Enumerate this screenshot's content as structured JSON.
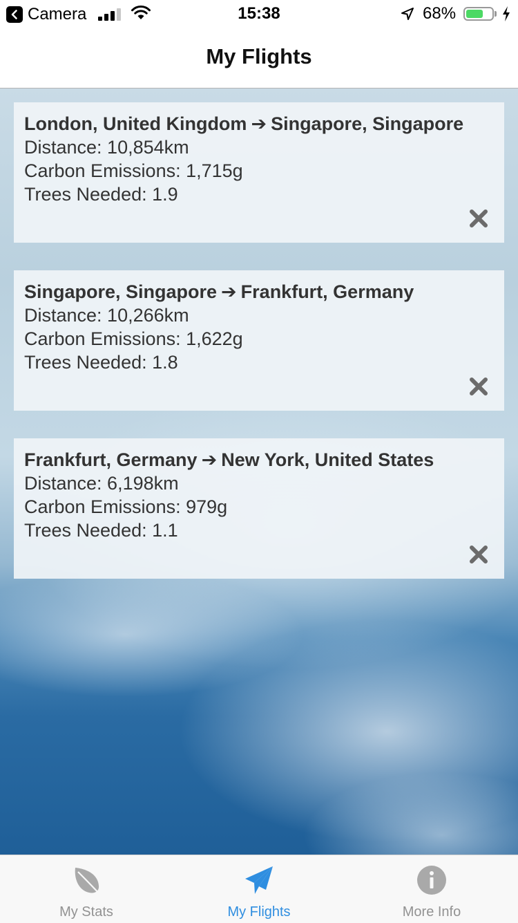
{
  "status_bar": {
    "back_app": "Camera",
    "time": "15:38",
    "battery_percent": "68%",
    "battery_level": 0.68,
    "signal_bars": 3,
    "charging": true
  },
  "nav": {
    "title": "My Flights"
  },
  "flights": [
    {
      "from": "London, United Kingdom",
      "to": "Singapore, Singapore",
      "distance": "Distance: 10,854km",
      "emissions": "Carbon Emissions: 1,715g",
      "trees": "Trees Needed: 1.9"
    },
    {
      "from": "Singapore, Singapore",
      "to": "Frankfurt, Germany",
      "distance": "Distance: 10,266km",
      "emissions": "Carbon Emissions: 1,622g",
      "trees": "Trees Needed: 1.8"
    },
    {
      "from": "Frankfurt, Germany",
      "to": "New York, United States",
      "distance": "Distance: 6,198km",
      "emissions": "Carbon Emissions: 979g",
      "trees": "Trees Needed: 1.1"
    }
  ],
  "route_arrow": "➔",
  "icons": {
    "delete": "close-icon",
    "back": "chevron-left-icon",
    "tab_stats": "leaf-icon",
    "tab_flights": "paper-plane-icon",
    "tab_info": "info-icon"
  },
  "tabs": [
    {
      "label": "My Stats",
      "icon": "leaf-icon",
      "active": false
    },
    {
      "label": "My Flights",
      "icon": "paper-plane-icon",
      "active": true
    },
    {
      "label": "More Info",
      "icon": "info-icon",
      "active": false
    }
  ],
  "colors": {
    "accent": "#2f8ee0",
    "inactive": "#929292",
    "battery": "#4cd964",
    "card_text": "#333333"
  }
}
